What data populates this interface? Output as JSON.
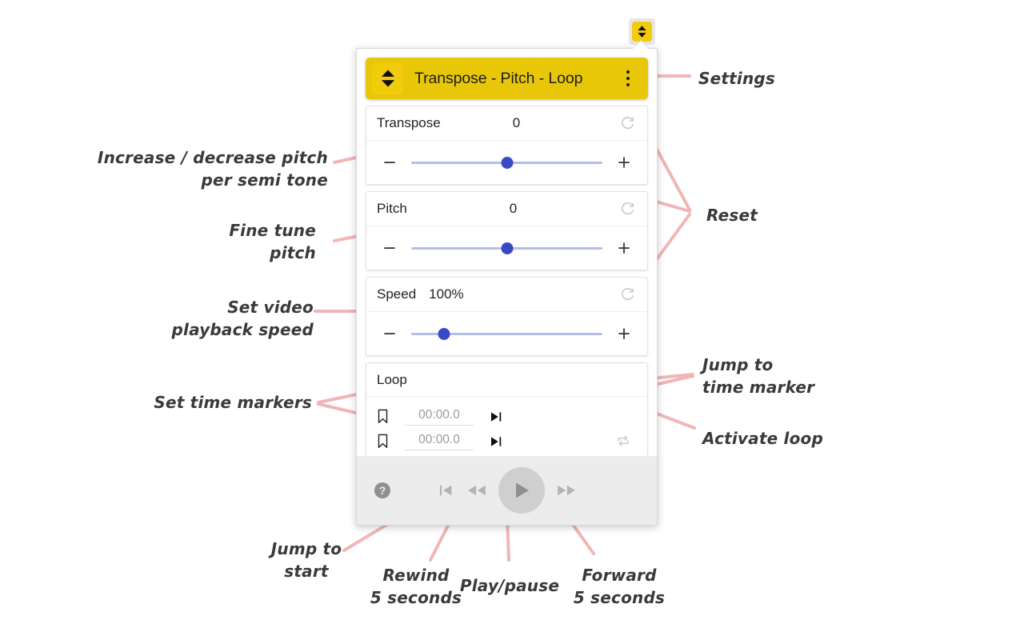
{
  "browser": {
    "extension_icon_name": "transpose-extension-toolbar-icon"
  },
  "popup": {
    "header": {
      "logo_icon": "up-down-triangle-logo",
      "title": "Transpose - Pitch - Loop",
      "menu_icon": "kebab-menu-icon"
    },
    "cards": [
      {
        "key": "transpose",
        "label": "Transpose",
        "value": "0",
        "reset_icon": "reset-circular-arrow-icon",
        "minus_label": "−",
        "plus_label": "+",
        "thumb_percent": 50
      },
      {
        "key": "pitch",
        "label": "Pitch",
        "value": "0",
        "reset_icon": "reset-circular-arrow-icon",
        "minus_label": "−",
        "plus_label": "+",
        "thumb_percent": 50
      },
      {
        "key": "speed",
        "label": "Speed",
        "value": "100%",
        "reset_icon": "reset-circular-arrow-icon",
        "minus_label": "−",
        "plus_label": "+",
        "thumb_percent": 17
      }
    ],
    "loop": {
      "title": "Loop",
      "bookmark_icon": "bookmark-icon",
      "jump_icon": "play-to-marker-icon",
      "toggle_icon": "repeat-loop-icon",
      "markers": [
        {
          "placeholder": "00:00.0",
          "value": "00:00.0"
        },
        {
          "placeholder": "00:00.0",
          "value": "00:00.0"
        }
      ]
    },
    "footer": {
      "help_icon": "help-question-icon",
      "jump_start_icon": "skip-to-start-icon",
      "rewind_icon": "rewind-5-seconds-icon",
      "play_icon": "play-pause-icon",
      "forward_icon": "forward-5-seconds-icon"
    }
  },
  "colors": {
    "brand_yellow": "#e8c709",
    "logo_yellow": "#f2cc0c",
    "slider_track": "#b7bdea",
    "slider_thumb": "#3949c4",
    "annotation_pink": "#f0b6b6",
    "footer_gray": "#ececec"
  },
  "annotations": [
    {
      "key": "settings",
      "text": "Settings"
    },
    {
      "key": "increase_pitch",
      "text": "Increase / decrease pitch\nper semi tone"
    },
    {
      "key": "reset",
      "text": "Reset"
    },
    {
      "key": "fine_tune",
      "text": "Fine tune\npitch"
    },
    {
      "key": "playback_speed",
      "text": "Set video\nplayback speed"
    },
    {
      "key": "jump_marker",
      "text": "Jump to\ntime marker"
    },
    {
      "key": "time_markers",
      "text": "Set time markers"
    },
    {
      "key": "activate_loop",
      "text": "Activate loop"
    },
    {
      "key": "jump_start",
      "text": "Jump to\nstart"
    },
    {
      "key": "rewind",
      "text": "Rewind\n5 seconds"
    },
    {
      "key": "play_pause",
      "text": "Play/pause"
    },
    {
      "key": "forward",
      "text": "Forward\n5 seconds"
    }
  ]
}
